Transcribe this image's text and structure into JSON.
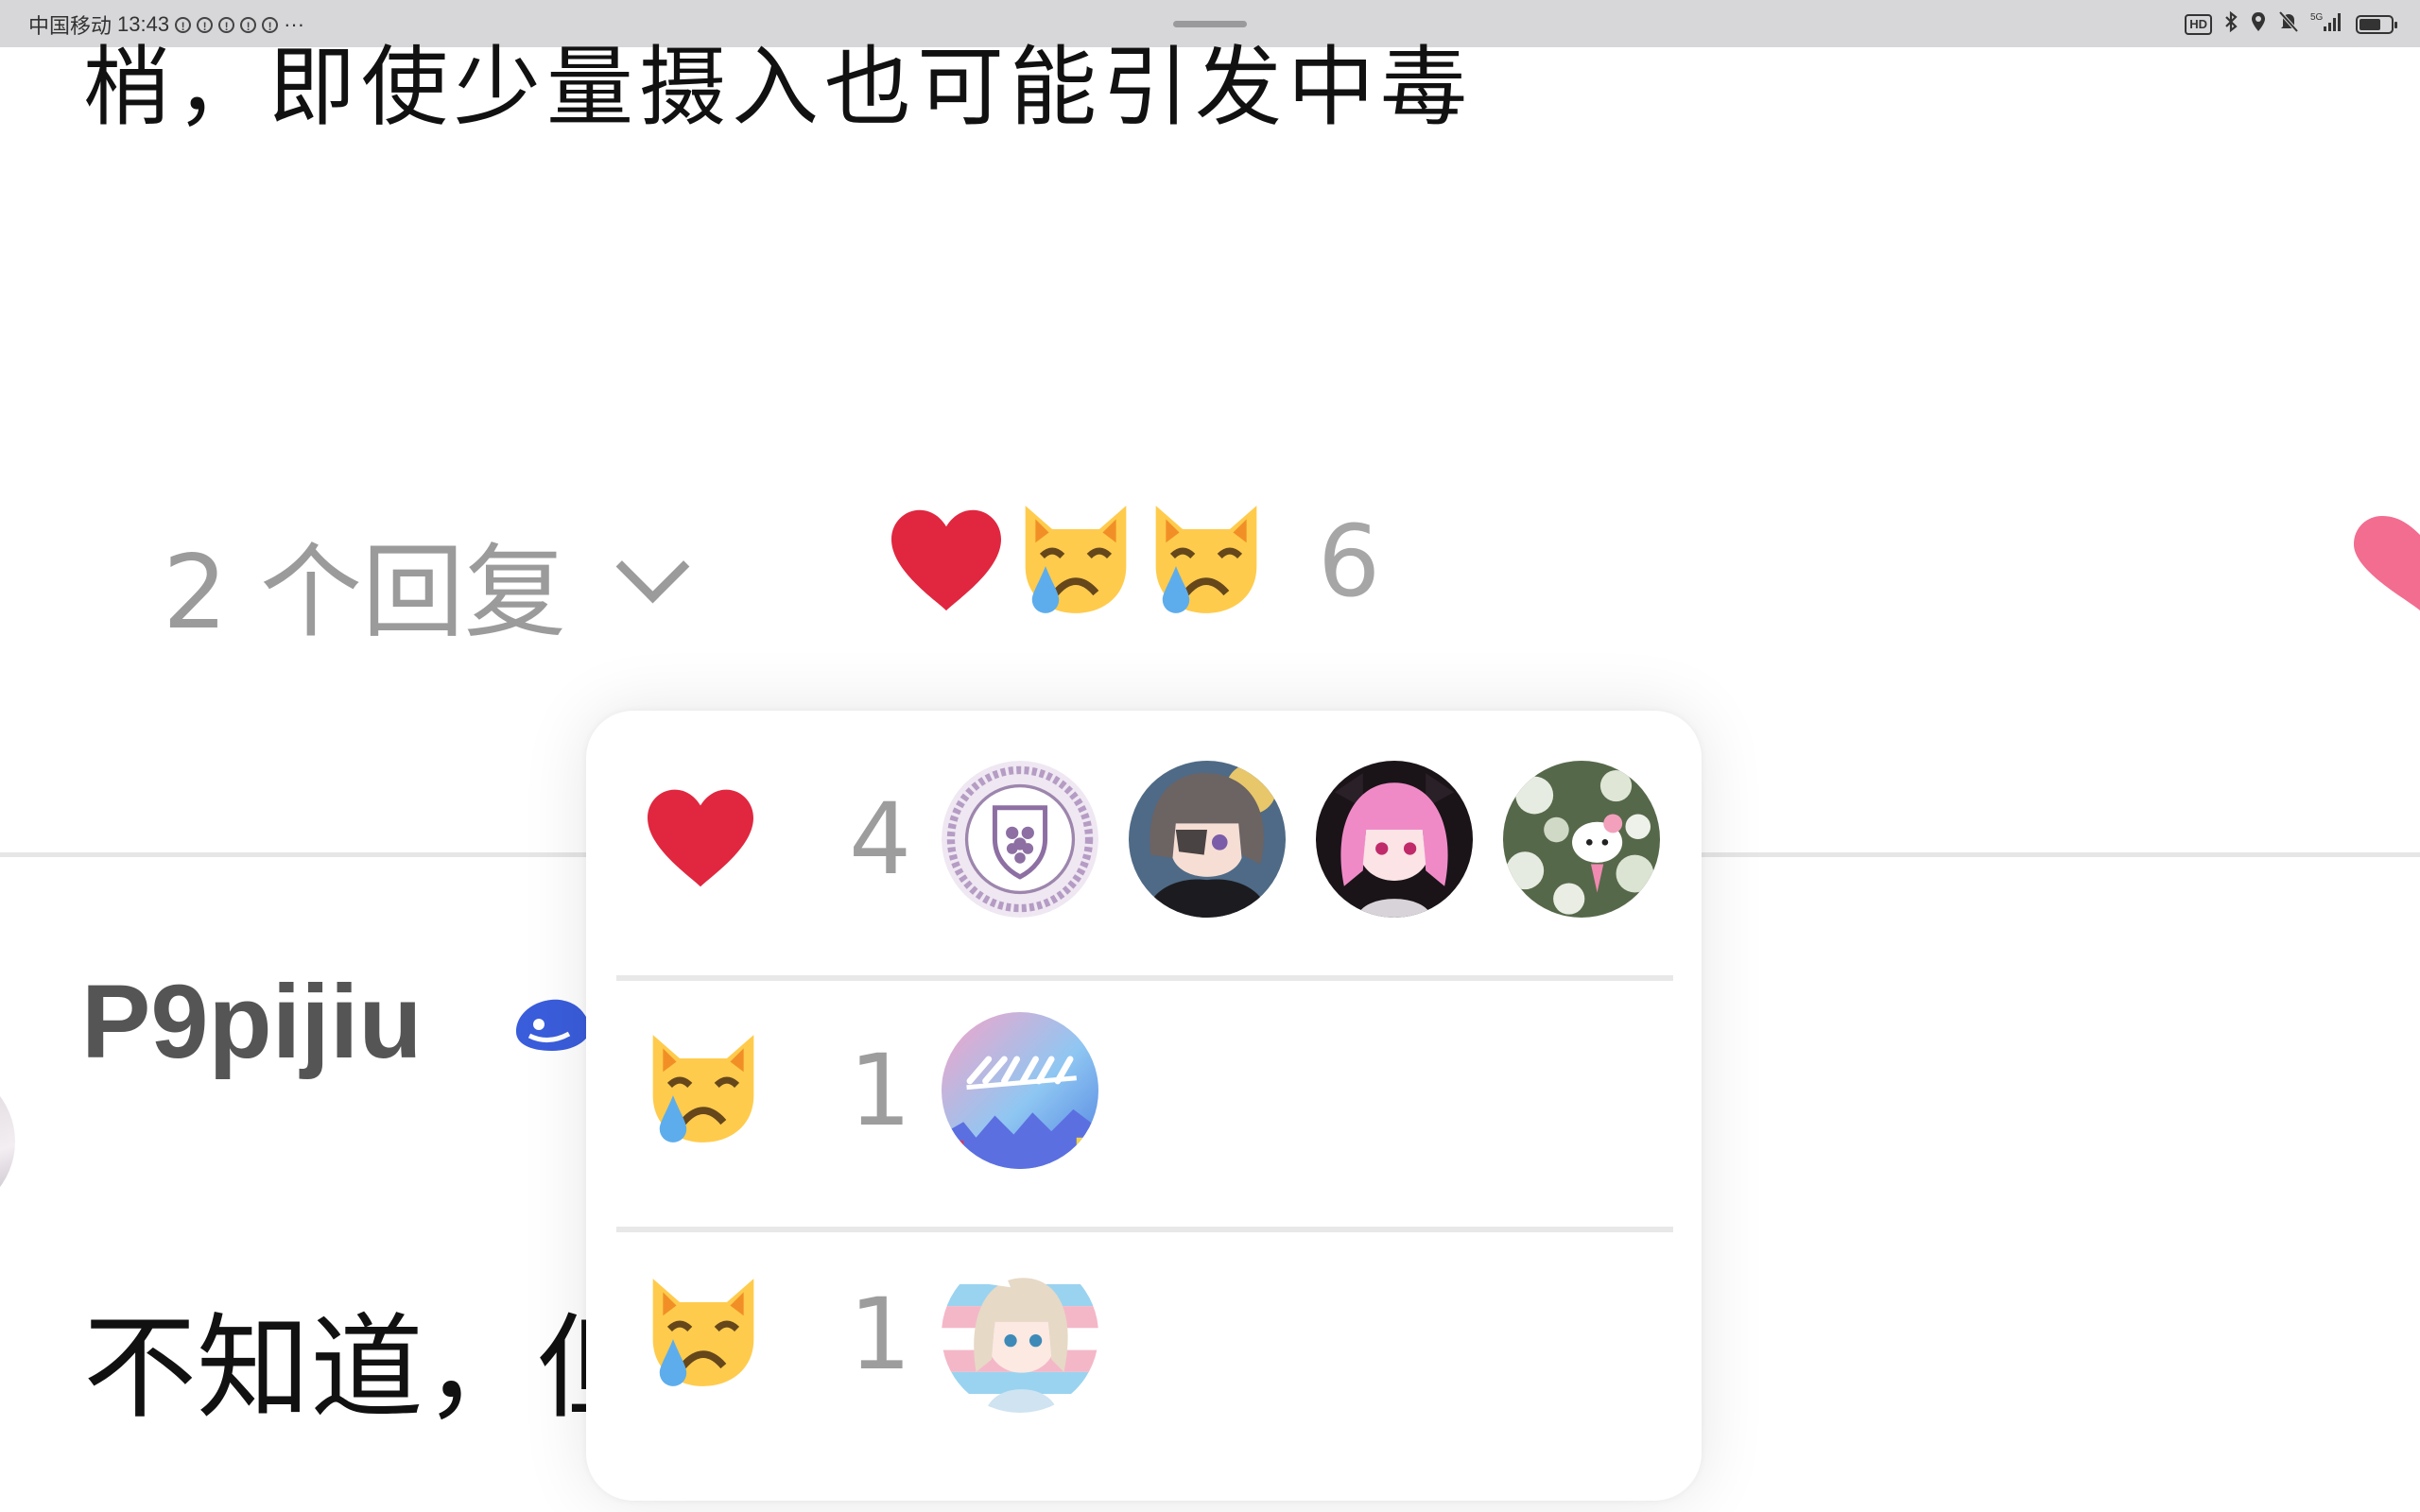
{
  "status_bar": {
    "carrier": "中国移动",
    "time": "13:43",
    "alert_count": 5,
    "more": "···",
    "hd": "HD",
    "signal": "5G",
    "battery_percent": 60
  },
  "comment_text_partial": "梢，即使少量摄入也可能引发中毒",
  "replies": {
    "label": "2 个回复",
    "expand_icon": "chevron-down-icon"
  },
  "reaction_summary": {
    "emojis": [
      "red-heart",
      "crying-cat",
      "crying-cat"
    ],
    "count": "6"
  },
  "like_icon": "heart-icon",
  "next_comment": {
    "username": "P9pijiu",
    "badge_icon": "whale-badge-icon",
    "text_partial": "不知道，但"
  },
  "reaction_popup": {
    "rows": [
      {
        "emoji": "red-heart",
        "count": "4",
        "avatars": [
          "grape-emblem-avatar",
          "grey-hair-anime-avatar",
          "pink-hair-anime-avatar",
          "hello-kitty-flowers-avatar"
        ]
      },
      {
        "emoji": "crying-cat",
        "count": "1",
        "avatars": [
          "pink-blue-art-avatar"
        ]
      },
      {
        "emoji": "crying-cat",
        "count": "1",
        "avatars": [
          "blonde-anime-girl-avatar"
        ]
      }
    ]
  },
  "colors": {
    "heart_red": "#e0273f",
    "like_pink": "#f26d8f",
    "badge_blue": "#3a5ddc",
    "muted_text": "#9b9b9b"
  }
}
